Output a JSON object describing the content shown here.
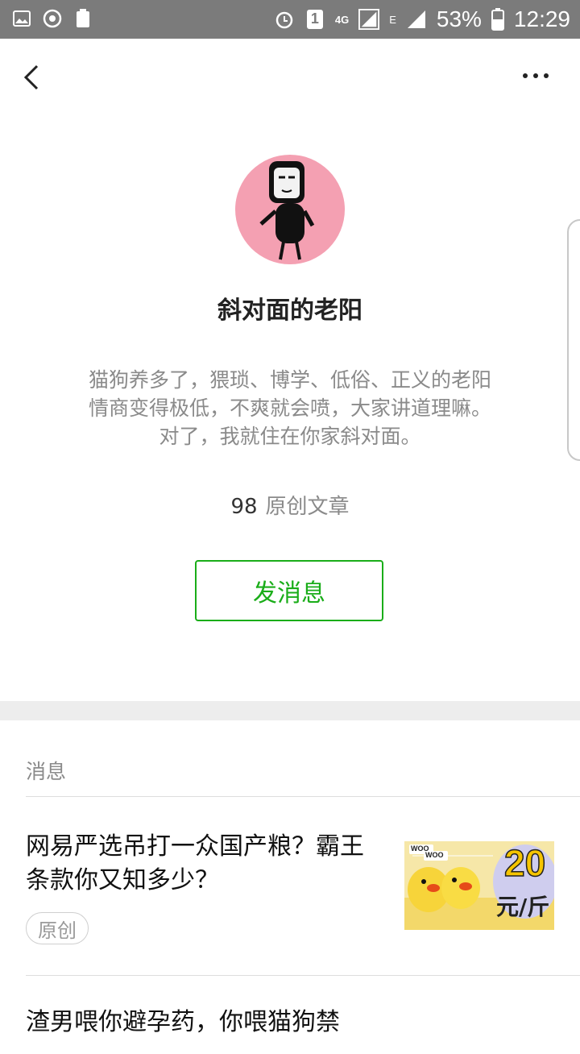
{
  "status_bar": {
    "network_4g": "4G",
    "network_e": "E",
    "sim_slot": "1",
    "battery": "53%",
    "time": "12:29"
  },
  "profile": {
    "name": "斜对面的老阳",
    "bio": "猫狗养多了，猥琐、博学、低俗、正义的老阳情商变得极低，不爽就会喷，大家讲道理嘛。对了，我就住在你家斜对面。",
    "article_count": "98",
    "article_count_label": "原创文章",
    "message_button": "发消息"
  },
  "section": {
    "title": "消息"
  },
  "articles": [
    {
      "title": "网易严选吊打一众国产粮？霸王条款你又知多少？",
      "tag": "原创",
      "thumb_text_top": "WOO",
      "thumb_text_mid": "WOO",
      "thumb_text_price": "20",
      "thumb_text_unit": "元/斤"
    },
    {
      "title": "渣男喂你避孕药，你喂猫狗禁"
    }
  ],
  "colors": {
    "accent_green": "#1aad19",
    "status_bar": "#7b7b7b",
    "avatar_bg": "#f4a0b2"
  }
}
